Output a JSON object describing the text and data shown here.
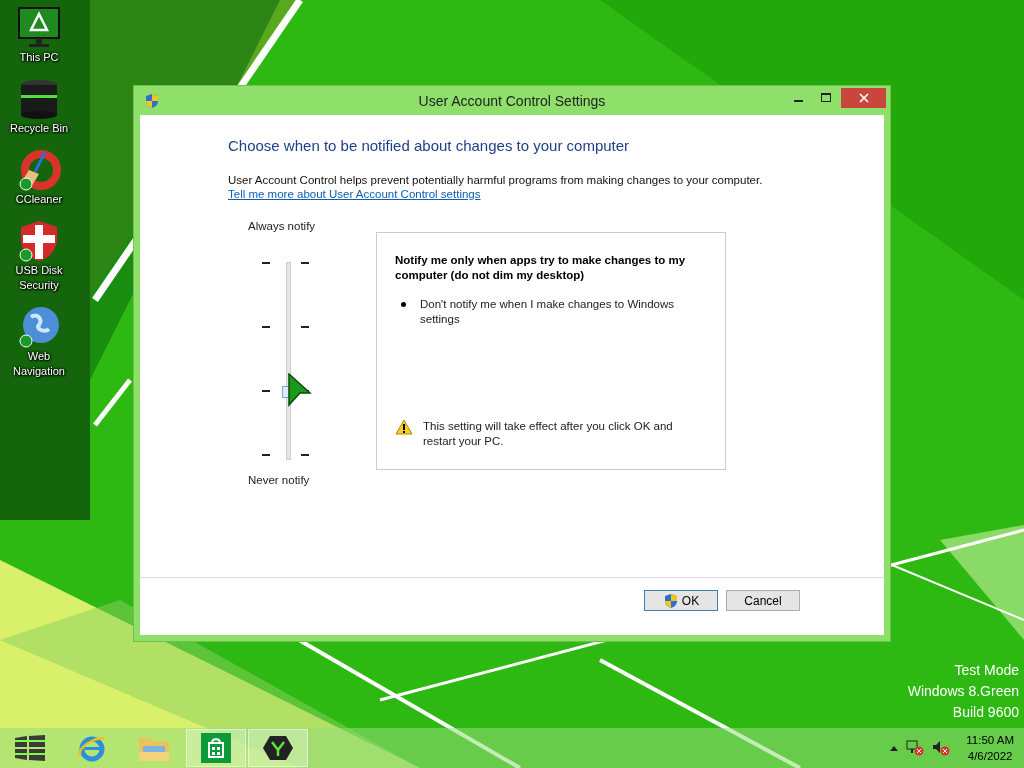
{
  "desktop_icons": [
    {
      "label": "This PC",
      "kind": "monitor"
    },
    {
      "label": "Recycle Bin",
      "kind": "bin"
    },
    {
      "label": "CCleaner",
      "kind": "cleaner"
    },
    {
      "label": "USB Disk Security",
      "kind": "shield"
    },
    {
      "label": "Web Navigation",
      "kind": "globe"
    }
  ],
  "window": {
    "title": "User Account Control Settings",
    "heading": "Choose when to be notified about changes to your computer",
    "description": "User Account Control helps prevent potentially harmful programs from making changes to your computer.",
    "link": "Tell me more about User Account Control settings",
    "slider": {
      "top_label": "Always notify",
      "bottom_label": "Never notify",
      "level": 0.33
    },
    "info": {
      "title": "Notify me only when apps try to make changes to my computer (do not dim my desktop)",
      "bullets": [
        "Don't notify me when I make changes to Windows settings"
      ],
      "warning": "This setting will take effect after you click OK and restart your PC."
    },
    "buttons": [
      {
        "label": "OK",
        "kind": "shield"
      },
      {
        "label": "Cancel",
        "kind": "plain"
      }
    ]
  },
  "watermark_lines": [
    "Test Mode",
    "Windows 8.Green",
    "Build 9600"
  ],
  "taskbar": {
    "items": [
      {
        "kind": "start",
        "running": false
      },
      {
        "kind": "browser",
        "running": false
      },
      {
        "kind": "folder",
        "running": false
      },
      {
        "kind": "store",
        "running": true
      },
      {
        "kind": "app",
        "running": true
      }
    ],
    "clock": {
      "time": "11:50 AM",
      "date": "4/6/2022"
    }
  }
}
